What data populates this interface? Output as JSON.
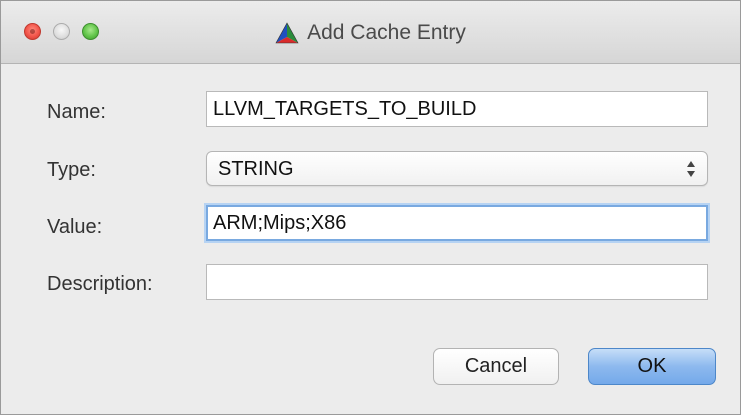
{
  "window": {
    "title": "Add Cache Entry",
    "title_icon": "cmake-triangle-icon"
  },
  "form": {
    "name_label": "Name:",
    "name_value": "LLVM_TARGETS_TO_BUILD",
    "type_label": "Type:",
    "type_value": "STRING",
    "value_label": "Value:",
    "value_value": "ARM;Mips;X86",
    "description_label": "Description:",
    "description_value": ""
  },
  "buttons": {
    "cancel_label": "Cancel",
    "ok_label": "OK"
  },
  "colors": {
    "focus_ring": "#79a9e0",
    "default_button": "#8db9ee",
    "close_button": "#f2554a",
    "zoom_button": "#62c54a"
  }
}
